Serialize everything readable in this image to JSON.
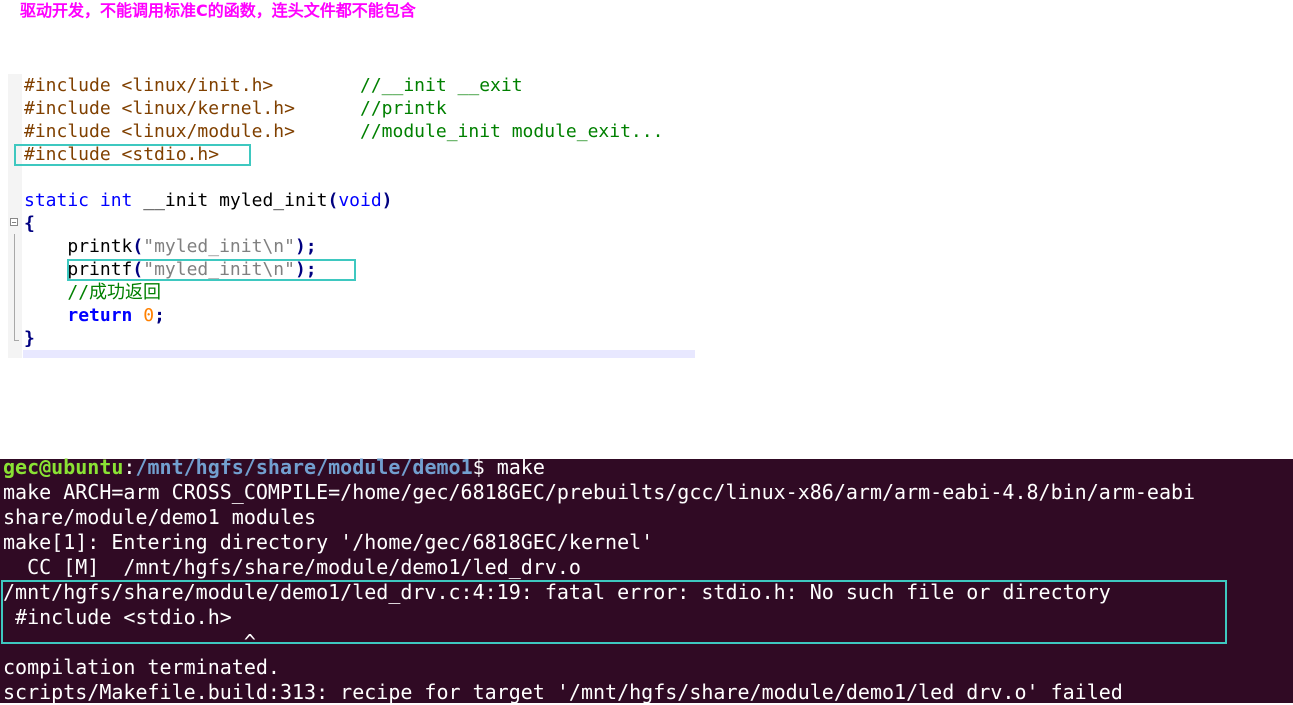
{
  "note_title": "驱动开发，不能调用标准C的函数，连头文件都不能包含",
  "code": {
    "inc1": "#include <linux/init.h>",
    "cmt1": "//__init __exit",
    "inc2": "#include <linux/kernel.h>",
    "cmt2": "//printk",
    "inc3": "#include <linux/module.h>",
    "cmt3": "//module_init module_exit...",
    "inc4": "#include <stdio.h>",
    "kw_static": "static",
    "kw_int": "int",
    "func_decl": "__init myled_init",
    "paren_open": "(",
    "kw_void": "void",
    "paren_close": ")",
    "brace_open": "{",
    "printk_name": "printk",
    "printf_name": "printf",
    "call_open": "(",
    "str_myled": "\"myled_init\\n\"",
    "call_close": ");",
    "comment_success": "//成功返回",
    "kw_return": "return",
    "num_zero": "0",
    "semicolon": ";",
    "brace_close": "}"
  },
  "terminal": {
    "prompt_user": "gec@ubuntu",
    "prompt_sep": ":",
    "prompt_path": "/mnt/hgfs/share/module/demo1",
    "prompt_cmd": "$ make",
    "lines": [
      "make ARCH=arm CROSS_COMPILE=/home/gec/6818GEC/prebuilts/gcc/linux-x86/arm/arm-eabi-4.8/bin/arm-eabi",
      "share/module/demo1 modules",
      "make[1]: Entering directory '/home/gec/6818GEC/kernel'",
      "  CC [M]  /mnt/hgfs/share/module/demo1/led_drv.o",
      "/mnt/hgfs/share/module/demo1/led_drv.c:4:19: fatal error: stdio.h: No such file or directory",
      " #include <stdio.h>",
      "                    ^",
      "compilation terminated.",
      "scripts/Makefile.build:313: recipe for target '/mnt/hgfs/share/module/demo1/led_drv.o' failed"
    ]
  },
  "colors": {
    "title": "#ff00ff",
    "highlight_box": "#3ec8c0",
    "terminal_bg": "#300a24",
    "prompt_user": "#8ae234",
    "prompt_path": "#729fcf"
  }
}
